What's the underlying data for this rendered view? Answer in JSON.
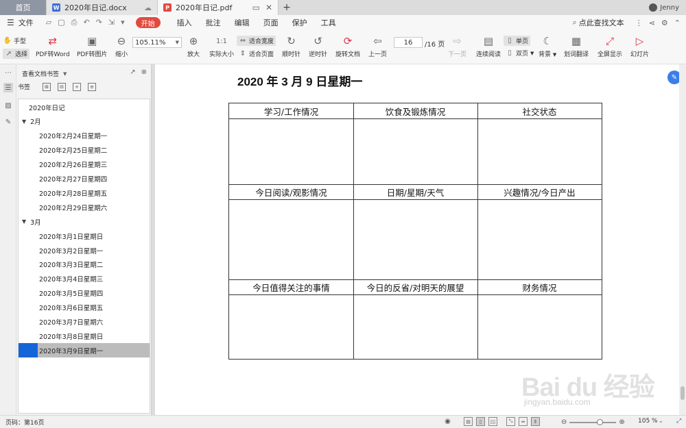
{
  "tabs": {
    "home": "首页",
    "docx": "2020年日记.docx",
    "pdf": "2020年日记.pdf",
    "user": "Jenny"
  },
  "menubar": {
    "file": "文件",
    "start": "开始",
    "items": [
      "插入",
      "批注",
      "编辑",
      "页面",
      "保护",
      "工具"
    ],
    "find": "点此查找文本"
  },
  "toolbar": {
    "hand": "手型",
    "select": "选择",
    "pdf2word": "PDF转Word",
    "pdf2img": "PDF转图片",
    "zoom_out": "缩小",
    "zoom_value": "105.11%",
    "zoom_in": "放大",
    "actual_size": "实际大小",
    "fit_width": "适合宽度",
    "fit_page": "适合页面",
    "rotate_cw": "顺时针",
    "rotate_ccw": "逆时针",
    "rotate_doc": "旋转文档",
    "prev_page": "上一页",
    "current_page": "16",
    "total_pages": "/16 页",
    "next_page": "下一页",
    "continuous": "连续阅读",
    "single": "单页",
    "double": "双页",
    "background": "背景",
    "translate": "划词翻译",
    "fullscreen": "全屏显示",
    "slideshow": "幻灯片"
  },
  "sidebar": {
    "header": "查看文档书签",
    "tab_label": "书签",
    "tree": [
      {
        "label": "2020年日记",
        "level": 0
      },
      {
        "label": "2月",
        "level": 0,
        "arrow": "▼"
      },
      {
        "label": "2020年2月24日星期一",
        "level": 1
      },
      {
        "label": "2020年2月25日星期二",
        "level": 1
      },
      {
        "label": "2020年2月26日星期三",
        "level": 1
      },
      {
        "label": "2020年2月27日星期四",
        "level": 1
      },
      {
        "label": "2020年2月28日星期五",
        "level": 1
      },
      {
        "label": "2020年2月29日星期六",
        "level": 1
      },
      {
        "label": "3月",
        "level": 0,
        "arrow": "▼"
      },
      {
        "label": "2020年3月1日星期日",
        "level": 1
      },
      {
        "label": "2020年3月2日星期一",
        "level": 1
      },
      {
        "label": "2020年3月3日星期二",
        "level": 1
      },
      {
        "label": "2020年3月4日星期三",
        "level": 1
      },
      {
        "label": "2020年3月5日星期四",
        "level": 1
      },
      {
        "label": "2020年3月6日星期五",
        "level": 1
      },
      {
        "label": "2020年3月7日星期六",
        "level": 1
      },
      {
        "label": "2020年3月8日星期日",
        "level": 1
      },
      {
        "label": "2020年3月9日星期一",
        "level": 1,
        "selected": true
      }
    ]
  },
  "document": {
    "title": "2020 年 3 月 9 日星期一",
    "cells": [
      "学习/工作情况",
      "饮食及锻炼情况",
      "社交状态",
      "今日阅读/观影情况",
      "日期/星期/天气",
      "兴趣情况/今日产出",
      "今日值得关注的事情",
      "今日的反省/对明天的展望",
      "财务情况"
    ]
  },
  "statusbar": {
    "page_info": "页码：第16页",
    "zoom": "105 %"
  },
  "watermark": {
    "text": "Bai du 经验",
    "sub": "jingyan.baidu.com"
  },
  "colors": {
    "accent_red": "#e34a3e",
    "selection_blue": "#1565d8",
    "float_blue": "#3a7ee8"
  }
}
